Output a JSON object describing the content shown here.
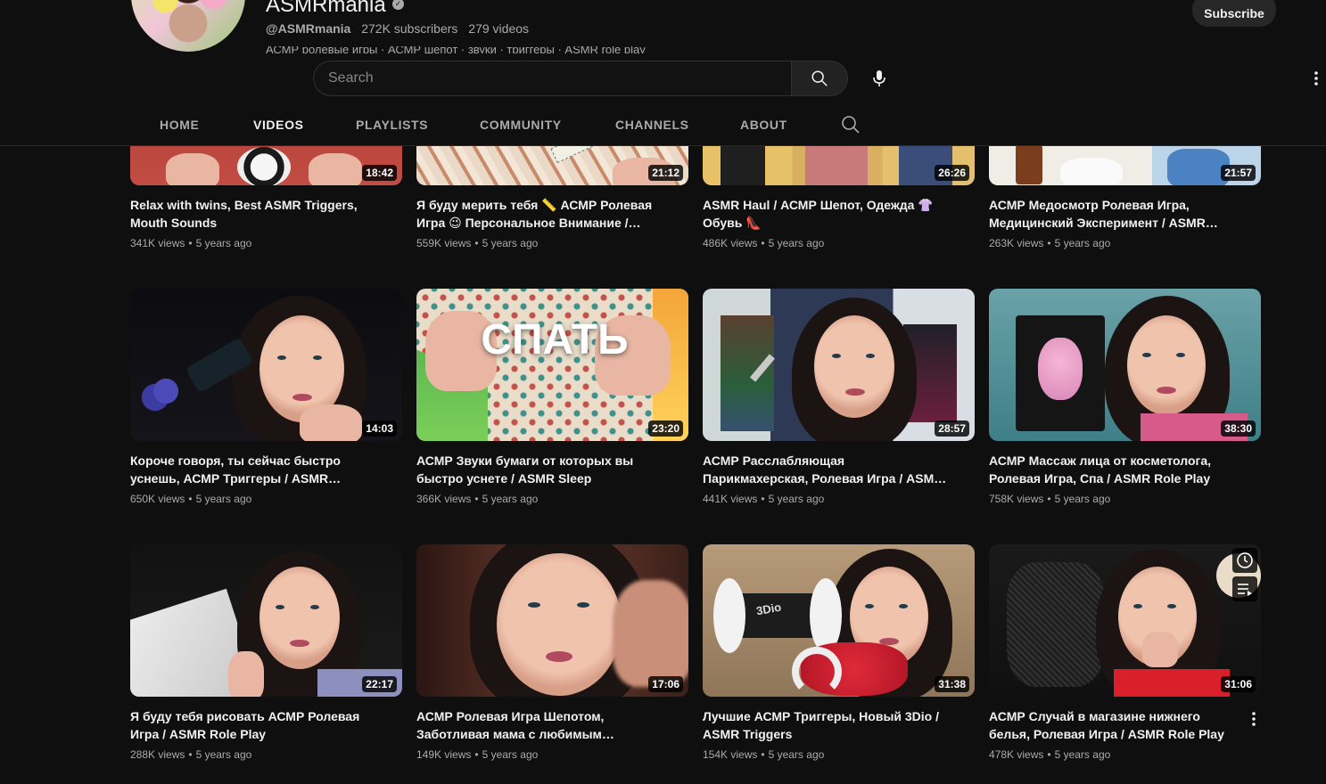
{
  "channel": {
    "name": "ASMRmania",
    "handle": "@ASMRmania",
    "subscribers": "272K subscribers",
    "videos_count": "279 videos",
    "description_peek": "АСМР ролевые игры · АСМР шепот · звуки · триггеры · ASMR role play",
    "subscribe_label": "Subscribe"
  },
  "search": {
    "placeholder": "Search"
  },
  "tabs": [
    {
      "label": "HOME"
    },
    {
      "label": "VIDEOS"
    },
    {
      "label": "PLAYLISTS"
    },
    {
      "label": "COMMUNITY"
    },
    {
      "label": "CHANNELS"
    },
    {
      "label": "ABOUT"
    }
  ],
  "active_tab": "VIDEOS",
  "videos": [
    {
      "title": "Relax with twins, Best ASMR Triggers, Mouth Sounds",
      "views": "341K views",
      "age": "5 years ago",
      "duration": "18:42"
    },
    {
      "title": "Я буду мерить тебя 📏 АСМР Ролевая Игра 😉 Персональное Внимание / ASMR Personal Attention",
      "views": "559K views",
      "age": "5 years ago",
      "duration": "21:12"
    },
    {
      "title": "ASMR Haul / АСМР Шепот, Одежда 👚 Обувь 👠",
      "views": "486K views",
      "age": "5 years ago",
      "duration": "26:26"
    },
    {
      "title": "АСМР Медосмотр Ролевая Игра, Медицинский Эксперимент / ASMR Medical Exam",
      "views": "263K views",
      "age": "5 years ago",
      "duration": "21:57"
    },
    {
      "title": "Короче говоря, ты сейчас быстро уснешь, АСМР Триггеры / ASMR Triggers",
      "views": "650K views",
      "age": "5 years ago",
      "duration": "14:03"
    },
    {
      "title": "АСМР Звуки бумаги от которых вы быстро уснете / ASMR Sleep",
      "views": "366K views",
      "age": "5 years ago",
      "duration": "23:20",
      "thumb_text": "СПАТЬ"
    },
    {
      "title": "АСМР Расслабляющая Парикмахерская, Ролевая Игра / ASMR Role Play",
      "views": "441K views",
      "age": "5 years ago",
      "duration": "28:57"
    },
    {
      "title": "АСМР Массаж лица от косметолога, Ролевая Игра, Спа / ASMR Role Play",
      "views": "758K views",
      "age": "5 years ago",
      "duration": "38:30"
    },
    {
      "title": "Я буду тебя рисовать АСМР Ролевая Игра / ASMR Role Play",
      "views": "288K views",
      "age": "5 years ago",
      "duration": "22:17"
    },
    {
      "title": "АСМР Ролевая Игра Шепотом, Заботливая мама с любимым сыночком / ASMR Role Play",
      "views": "149K views",
      "age": "5 years ago",
      "duration": "17:06"
    },
    {
      "title": "Лучшие АСМР Триггеры, Новый 3Dio / ASMR Triggers",
      "views": "154K views",
      "age": "5 years ago",
      "duration": "31:38",
      "thumb_text": "3Dio"
    },
    {
      "title": "АСМР Случай в магазине нижнего белья, Ролевая Игра / ASMR Role Play",
      "views": "478K views",
      "age": "5 years ago",
      "duration": "31:06"
    }
  ],
  "icons": {
    "verified": "verified-check-icon",
    "search": "search-icon",
    "mic": "microphone-icon",
    "more": "more-vert-icon",
    "watch_later": "clock-icon",
    "add_to_queue": "queue-icon"
  },
  "colors": {
    "background": "#0f0f0f",
    "text_primary": "#f1f1f1",
    "text_secondary": "#aaaaaa",
    "subscribe_bg": "#272727"
  }
}
